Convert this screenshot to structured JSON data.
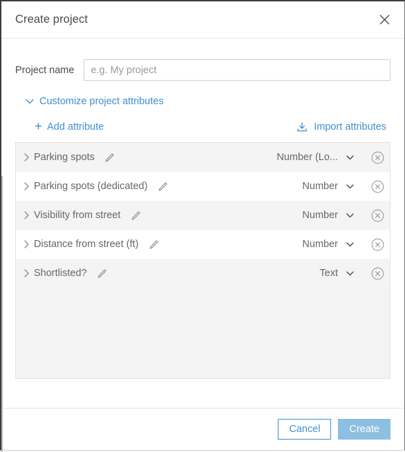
{
  "dialog": {
    "title": "Create project",
    "close_icon": "close-icon"
  },
  "form": {
    "project_name_label": "Project name",
    "project_name_value": "",
    "project_name_placeholder": "e.g. My project"
  },
  "customize": {
    "label": "Customize project attributes",
    "caret_icon": "chevron-down-icon",
    "expanded": true
  },
  "actions": {
    "add_attribute_label": "Add attribute",
    "add_icon": "plus-icon",
    "import_attributes_label": "Import attributes",
    "import_icon": "download-icon"
  },
  "attributes": {
    "rows": [
      {
        "name": "Parking spots",
        "type": "Number (Lo…)",
        "type_display": "Number (Lo...",
        "expand_icon": "chevron-right-icon",
        "edit_icon": "pencil-icon",
        "delete_icon": "remove-circle-icon"
      },
      {
        "name": "Parking spots (dedicated)",
        "type": "Number",
        "type_display": "Number",
        "expand_icon": "chevron-right-icon",
        "edit_icon": "pencil-icon",
        "delete_icon": "remove-circle-icon"
      },
      {
        "name": "Visibility from street",
        "type": "Number",
        "type_display": "Number",
        "expand_icon": "chevron-right-icon",
        "edit_icon": "pencil-icon",
        "delete_icon": "remove-circle-icon"
      },
      {
        "name": "Distance from street (ft)",
        "type": "Number",
        "type_display": "Number",
        "expand_icon": "chevron-right-icon",
        "edit_icon": "pencil-icon",
        "delete_icon": "remove-circle-icon"
      },
      {
        "name": "Shortlisted?",
        "type": "Text",
        "type_display": "Text",
        "expand_icon": "chevron-right-icon",
        "edit_icon": "pencil-icon",
        "delete_icon": "remove-circle-icon"
      }
    ]
  },
  "footer": {
    "cancel_label": "Cancel",
    "create_label": "Create"
  },
  "colors": {
    "link_blue": "#3f8fd0",
    "primary_disabled": "#8cbfe0",
    "row_alt": "#f4f4f4",
    "list_bg": "#f3f3f3",
    "text": "#666666"
  }
}
